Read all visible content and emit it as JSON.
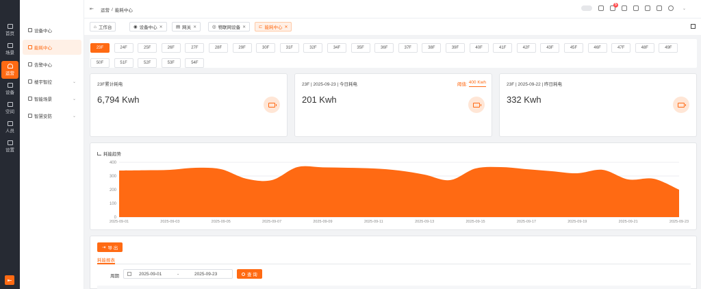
{
  "rail": {
    "items": [
      {
        "label": "首页",
        "icon": "home-icon"
      },
      {
        "label": "场景",
        "icon": "scene-icon"
      },
      {
        "label": "运营",
        "icon": "operation-icon"
      },
      {
        "label": "设备",
        "icon": "device-icon"
      },
      {
        "label": "空间",
        "icon": "space-icon"
      },
      {
        "label": "人员",
        "icon": "people-icon"
      },
      {
        "label": "设置",
        "icon": "settings-icon"
      }
    ],
    "active_index": 2
  },
  "submenu": {
    "items": [
      {
        "label": "设备中心",
        "has_children": false
      },
      {
        "label": "能耗中心",
        "has_children": false
      },
      {
        "label": "告警中心",
        "has_children": false
      },
      {
        "label": "楼宇智控",
        "has_children": true
      },
      {
        "label": "智能场景",
        "has_children": true
      },
      {
        "label": "智慧安防",
        "has_children": true
      }
    ],
    "active_index": 1
  },
  "header": {
    "breadcrumb": [
      "运营",
      "/",
      "能耗中心"
    ],
    "notification_count": "5"
  },
  "tabs": [
    {
      "label": "工作台",
      "closable": false
    },
    {
      "label": "设备中心",
      "closable": true
    },
    {
      "label": "网关",
      "closable": true
    },
    {
      "label": "物联网设备",
      "closable": true
    },
    {
      "label": "能耗中心",
      "closable": true
    }
  ],
  "active_tab": 4,
  "floors": {
    "items": [
      "23F",
      "24F",
      "25F",
      "26F",
      "27F",
      "28F",
      "29F",
      "30F",
      "31F",
      "32F",
      "34F",
      "35F",
      "36F",
      "37F",
      "38F",
      "39F",
      "40F",
      "41F",
      "42F",
      "43F",
      "45F",
      "46F",
      "47F",
      "48F",
      "49F",
      "50F",
      "51F",
      "52F",
      "53F",
      "54F"
    ],
    "active": "23F"
  },
  "cards": [
    {
      "title": "23F累计耗电",
      "value": "6,794 Kwh"
    },
    {
      "title": "23F | 2025-09-23 | 今日耗电",
      "value": "201 Kwh",
      "threshold_label": "阈值:",
      "threshold_value": "400 Kwh"
    },
    {
      "title": "23F | 2025-09-22 | 昨日耗电",
      "value": "332 Kwh"
    }
  ],
  "chart_title": "耗能趋势",
  "chart_data": {
    "type": "area",
    "color": "#ff6a13",
    "x": [
      "2025-09-01",
      "2025-09-02",
      "2025-09-03",
      "2025-09-04",
      "2025-09-05",
      "2025-09-06",
      "2025-09-07",
      "2025-09-08",
      "2025-09-09",
      "2025-09-10",
      "2025-09-11",
      "2025-09-12",
      "2025-09-13",
      "2025-09-14",
      "2025-09-15",
      "2025-09-16",
      "2025-09-17",
      "2025-09-18",
      "2025-09-19",
      "2025-09-20",
      "2025-09-21",
      "2025-09-22",
      "2025-09-23"
    ],
    "values": [
      340,
      342,
      345,
      360,
      350,
      280,
      270,
      365,
      363,
      360,
      355,
      340,
      310,
      270,
      355,
      365,
      350,
      335,
      320,
      345,
      275,
      280,
      200
    ],
    "xticks": [
      "2025-09-01",
      "2025-09-03",
      "2025-09-05",
      "2025-09-07",
      "2025-09-09",
      "2025-09-11",
      "2025-09-13",
      "2025-09-15",
      "2025-09-17",
      "2025-09-19",
      "2025-09-21",
      "2025-09-23"
    ],
    "yticks": [
      0,
      100,
      200,
      300,
      400
    ],
    "ylim": [
      0,
      400
    ]
  },
  "report": {
    "export_label": "导 出",
    "tab_label": "耗能报表",
    "period_label": "周期",
    "date_start": "2025-09-01",
    "date_sep": "-",
    "date_end": "2025-09-23",
    "query_label": "查 询"
  }
}
